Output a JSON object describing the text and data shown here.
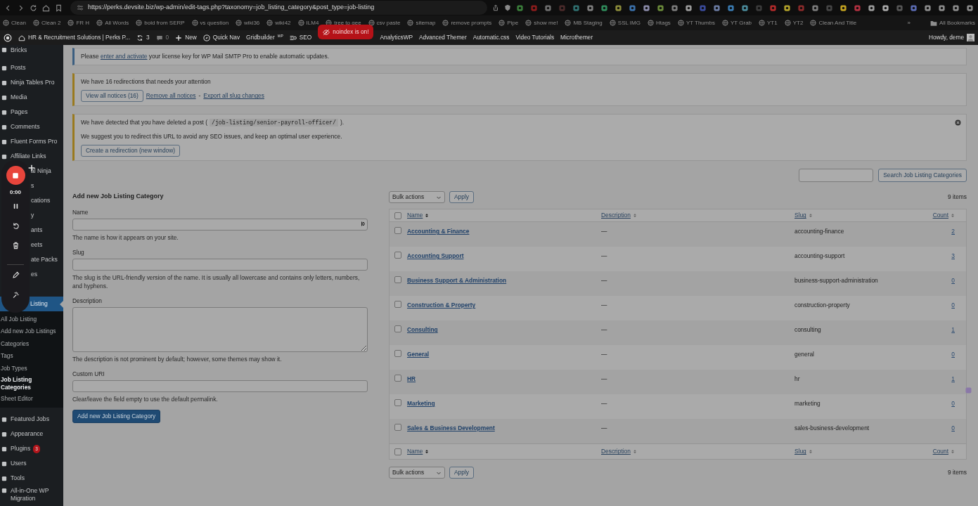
{
  "browser": {
    "url": "https://perks.devsite.biz/wp-admin/edit-tags.php?taxonomy=job_listing_category&post_type=job-listing",
    "bookmarks": [
      "Clean",
      "Clean 2",
      "FR H",
      "All Words",
      "bold from SERP",
      "vs question",
      "wiki36",
      "wiki42",
      "ILM4",
      "tree to gee",
      "csv paste",
      "sitemap",
      "remove prompts",
      "Pipe",
      "show me!",
      "MB Staging",
      "SSL IMG",
      "Htags",
      "YT Thumbs",
      "YT Grab",
      "YT1",
      "YT2",
      "Clean And Title"
    ],
    "overflow": "»",
    "all_bookmarks": "All Bookmarks"
  },
  "admin_bar": {
    "items": [
      {
        "kind": "home",
        "label": "HR & Recruitment Solutions | Perks P..."
      },
      {
        "kind": "updates",
        "label": "3"
      },
      {
        "kind": "comments",
        "label": "0"
      },
      {
        "kind": "new",
        "label": "New"
      },
      {
        "kind": "quicknav",
        "label": "Quick Nav"
      },
      {
        "kind": "text",
        "label": "Gridbuilder$^{WP}$"
      },
      {
        "kind": "seo",
        "label": "SEO"
      },
      {
        "kind": "alert",
        "label": "noindex is on!"
      },
      {
        "kind": "text",
        "label": "AnalyticsWP"
      },
      {
        "kind": "text",
        "label": "Advanced Themer"
      },
      {
        "kind": "text",
        "label": "Automatic.css"
      },
      {
        "kind": "text",
        "label": "Video Tutorials"
      },
      {
        "kind": "text",
        "label": "Microthemer"
      }
    ],
    "greeting": "Howdy, deme"
  },
  "sidebar": {
    "items": [
      {
        "label": "Bricks",
        "covered": false,
        "selected": false
      },
      {
        "label": "Posts",
        "covered": false,
        "selected": false
      },
      {
        "label": "Ninja Tables Pro",
        "covered": false,
        "selected": false
      },
      {
        "label": "Media",
        "covered": false,
        "selected": false
      },
      {
        "label": "Pages",
        "covered": false,
        "selected": false
      },
      {
        "label": "Comments",
        "covered": false,
        "selected": false
      },
      {
        "label": "Fluent Forms Pro",
        "covered": false,
        "selected": false
      },
      {
        "label": "Affiliate Links",
        "covered": false,
        "selected": false
      },
      {
        "label": "al Ninja",
        "covered": true,
        "selected": false
      },
      {
        "label": "s",
        "covered": true,
        "selected": false
      },
      {
        "label": "cations",
        "covered": true,
        "selected": false
      },
      {
        "label": "y",
        "covered": true,
        "selected": false
      },
      {
        "label": "ants",
        "covered": true,
        "selected": false
      },
      {
        "label": "eets",
        "covered": true,
        "selected": false
      },
      {
        "label": "ate Packs",
        "covered": true,
        "selected": false
      },
      {
        "label": "es",
        "covered": true,
        "selected": false
      },
      {
        "label": "Listing",
        "covered": true,
        "selected": true,
        "children": [
          {
            "label": "All Job Listing",
            "selected": false
          },
          {
            "label": "Add new Job Listings",
            "selected": false
          },
          {
            "label": "Categories",
            "selected": false
          },
          {
            "label": "Tags",
            "selected": false
          },
          {
            "label": "Job Types",
            "selected": false
          },
          {
            "label": "Job Listing Categories",
            "selected": true
          },
          {
            "label": "Sheet Editor",
            "selected": false
          }
        ]
      },
      {
        "label": "Featured Jobs",
        "covered": false,
        "selected": false
      },
      {
        "label": "Appearance",
        "covered": false,
        "selected": false
      },
      {
        "label": "Plugins",
        "covered": false,
        "selected": false,
        "badge": "3"
      },
      {
        "label": "Users",
        "covered": false,
        "selected": false
      },
      {
        "label": "Tools",
        "covered": false,
        "selected": false
      },
      {
        "label": "All-in-One WP Migration",
        "covered": false,
        "selected": false
      }
    ]
  },
  "recorder": {
    "time": "0:00"
  },
  "notices": [
    {
      "kind": "info",
      "dismissible": false,
      "lines": [
        {
          "kind": "link_text",
          "before": "Please ",
          "link": "enter and activate",
          "after": " your license key for WP Mail SMTP Pro to enable automatic updates."
        }
      ]
    },
    {
      "kind": "warning",
      "dismissible": false,
      "lines": [
        {
          "kind": "text",
          "text": "We have 16 redirections that needs your attention"
        },
        {
          "kind": "actions",
          "button": "View all notices (16)",
          "links": [
            "Remove all notices",
            "Export all slug changes"
          ],
          "separator": "-"
        }
      ]
    },
    {
      "kind": "warning",
      "dismissible": true,
      "lines": [
        {
          "kind": "code_text",
          "before": "We have detected that you have deleted a post (",
          "code": "/job-listing/senior-payroll-officer/",
          "after": ")."
        },
        {
          "kind": "text",
          "text": "We suggest you to redirect this URL to avoid any SEO issues, and keep an optimal user experience."
        },
        {
          "kind": "actions",
          "button": "Create a redirection (new window)"
        }
      ]
    }
  ],
  "search": {
    "button": "Search Job Listing Categories"
  },
  "form": {
    "title": "Add new Job Listing Category",
    "fields": [
      {
        "label": "Name",
        "kind": "input_icon",
        "help": "The name is how it appears on your site."
      },
      {
        "label": "Slug",
        "kind": "input",
        "help": "The slug is the URL-friendly version of the name. It is usually all lowercase and contains only letters, numbers, and hyphens."
      },
      {
        "label": "Description",
        "kind": "textarea",
        "help": "The description is not prominent by default; however, some themes may show it."
      },
      {
        "label": "Custom URI",
        "kind": "input",
        "help": "Clear/leave the field empty to use the default permalink."
      }
    ],
    "submit": "Add new Job Listing Category"
  },
  "table": {
    "top_nav": {
      "bulk_actions": "Bulk actions",
      "apply": "Apply",
      "count": "9 items"
    },
    "header_checked": false,
    "footer_checked": false,
    "columns": [
      {
        "label": "Name",
        "sorted": true
      },
      {
        "label": "Description",
        "sorted": false
      },
      {
        "label": "Slug",
        "sorted": false
      },
      {
        "label": "Count",
        "sorted": false
      }
    ],
    "rows": [
      {
        "name": "Accounting & Finance",
        "description": "—",
        "slug": "accounting-finance",
        "count": "2",
        "checked": false
      },
      {
        "name": "Accounting Support",
        "description": "—",
        "slug": "accounting-support",
        "count": "3",
        "checked": false
      },
      {
        "name": "Business Support & Administration",
        "description": "—",
        "slug": "business-support-administration",
        "count": "0",
        "checked": false
      },
      {
        "name": "Construction & Property",
        "description": "—",
        "slug": "construction-property",
        "count": "0",
        "checked": false
      },
      {
        "name": "Consulting",
        "description": "—",
        "slug": "consulting",
        "count": "1",
        "checked": false
      },
      {
        "name": "General",
        "description": "—",
        "slug": "general",
        "count": "0",
        "checked": false
      },
      {
        "name": "HR",
        "description": "—",
        "slug": "hr",
        "count": "1",
        "checked": false
      },
      {
        "name": "Marketing",
        "description": "—",
        "slug": "marketing",
        "count": "0",
        "checked": false
      },
      {
        "name": "Sales & Business Development",
        "description": "—",
        "slug": "sales-business-development",
        "count": "0",
        "checked": false
      }
    ],
    "footer_columns": [
      {
        "label": "Name",
        "sorted": true
      },
      {
        "label": "Description",
        "sorted": false
      },
      {
        "label": "Slug",
        "sorted": false
      },
      {
        "label": "Count",
        "sorted": false
      }
    ],
    "bottom_nav": {
      "bulk_actions": "Bulk actions",
      "apply": "Apply",
      "count": "9 items"
    }
  }
}
